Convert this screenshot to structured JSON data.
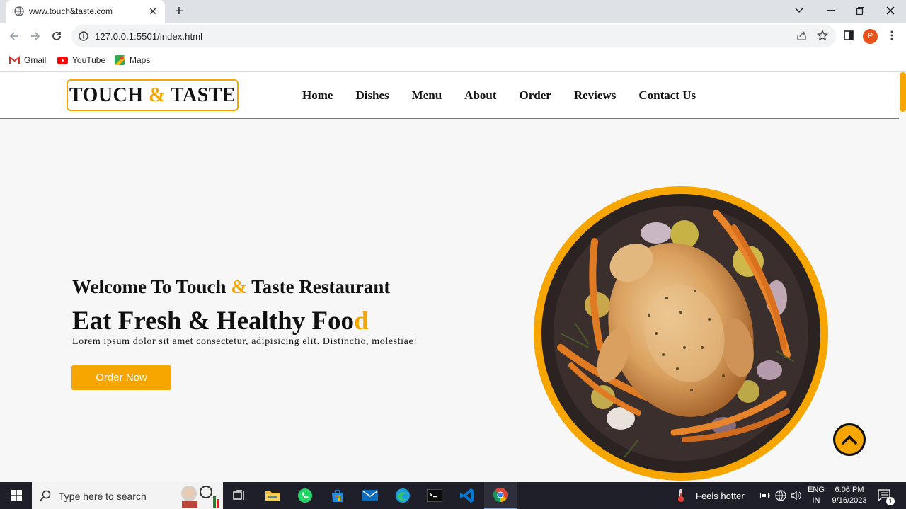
{
  "browser": {
    "tab_title": "www.touch&taste.com",
    "tab_close": "✕",
    "new_tab": "+",
    "url": "127.0.0.1:5501/index.html",
    "profile_initial": "P",
    "bookmarks": [
      "Gmail",
      "YouTube",
      "Maps"
    ]
  },
  "site": {
    "logo_left": "TOUCH ",
    "logo_amp": "&",
    "logo_right": " TASTE",
    "nav": [
      "Home",
      "Dishes",
      "Menu",
      "About",
      "Order",
      "Reviews",
      "Contact Us"
    ],
    "hero": {
      "subtitle_left": "Welcome To Touch ",
      "subtitle_amp": "&",
      "subtitle_right": " Taste Restaurant",
      "title_main": "Eat Fresh & Healthy Foo",
      "title_last": "d",
      "text": "Lorem ipsum dolor sit amet consectetur, adipisicing elit. Distinctio, molestiae!",
      "button": "Order Now"
    }
  },
  "taskbar": {
    "search_placeholder": "Type here to search",
    "weather": "Feels hotter",
    "lang_top": "ENG",
    "lang_bottom": "IN",
    "time": "6:06 PM",
    "date": "9/16/2023",
    "notification_count": "1"
  },
  "colors": {
    "accent": "#f7a600",
    "text": "#111111",
    "page_bg": "#f7f7f7"
  }
}
